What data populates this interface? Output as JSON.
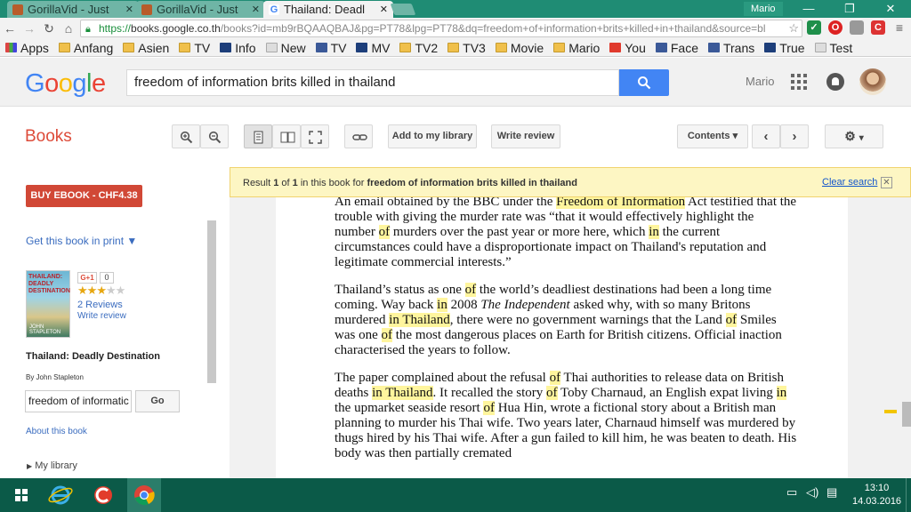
{
  "browser": {
    "tabs": [
      {
        "title": "GorillaVid - Just"
      },
      {
        "title": "GorillaVid - Just"
      },
      {
        "title": "Thailand: Deadl"
      }
    ],
    "window_user": "Mario",
    "url_https": "https://",
    "url_host": "books.google.co.th",
    "url_path": "/books?id=mb9rBQAAQBAJ&pg=PT78&lpg=PT78&dq=freedom+of+information+brits+killed+in+thailand&source=bl",
    "bookmarks": [
      "Apps",
      "Anfang",
      "Asien",
      "TV",
      "Info",
      "New",
      "TV",
      "MV",
      "TV2",
      "TV3",
      "Movie",
      "Mario",
      "You",
      "Face",
      "Trans",
      "True",
      "Test"
    ]
  },
  "google": {
    "search_query": "freedom of information brits killed in thailand",
    "username": "Mario"
  },
  "books": {
    "section_title": "Books",
    "add_library": "Add to my library",
    "write_review": "Write review",
    "contents": "Contents"
  },
  "result": {
    "prefix": "Result ",
    "n1": "1",
    "of": " of ",
    "n2": "1",
    "mid": " in this book for ",
    "query": "freedom of information brits killed in thailand",
    "clear": "Clear search"
  },
  "sidebar": {
    "buy": "BUY EBOOK - CHF4.38",
    "get_print": "Get this book in print ▼",
    "cover_title": "THAILAND: DEADLY DESTINATION",
    "cover_author": "JOHN STAPLETON",
    "gplus": "G+1",
    "gplus_count": "0",
    "rating": 3,
    "rating_max": 5,
    "reviews": "2 Reviews",
    "write_review": "Write review",
    "book_title": "Thailand: Deadly Destination",
    "by": "By John Stapleton",
    "search_value": "freedom of informatic",
    "go": "Go",
    "about": "About this book",
    "my_library": "My library"
  },
  "page_text": {
    "p1": [
      {
        "t": "An email obtained by the BBC under the "
      },
      {
        "t": "Freedom of Information",
        "h": true
      },
      {
        "t": " Act testified that the trouble with giving the murder rate was “that it would effectively highlight the number "
      },
      {
        "t": "of",
        "h": true
      },
      {
        "t": " murders over the past year or more here, which "
      },
      {
        "t": "in",
        "h": true
      },
      {
        "t": " the current circumstances could have a disproportionate impact on Thailand's reputation and legitimate commercial interests.”"
      }
    ],
    "p2": [
      {
        "t": "Thailand’s status as one "
      },
      {
        "t": "of",
        "h": true
      },
      {
        "t": " the world’s deadliest destinations had been a long time coming. Way back "
      },
      {
        "t": "in",
        "h": true
      },
      {
        "t": " 2008 "
      },
      {
        "t": "The Independent",
        "i": true
      },
      {
        "t": " asked why, with so many Britons murdered "
      },
      {
        "t": "in Thailand",
        "h": true
      },
      {
        "t": ", there were no government warnings that the Land "
      },
      {
        "t": "of",
        "h": true
      },
      {
        "t": " Smiles was one "
      },
      {
        "t": "of",
        "h": true
      },
      {
        "t": " the most dangerous places on Earth for British citizens. Official inaction characterised the years to follow."
      }
    ],
    "p3": [
      {
        "t": "The paper complained about the refusal "
      },
      {
        "t": "of",
        "h": true
      },
      {
        "t": " Thai authorities to release data on British deaths "
      },
      {
        "t": "in Thailand",
        "h": true
      },
      {
        "t": ". It recalled the story "
      },
      {
        "t": "of",
        "h": true
      },
      {
        "t": " Toby Charnaud, an English expat living "
      },
      {
        "t": "in",
        "h": true
      },
      {
        "t": " the upmarket seaside resort "
      },
      {
        "t": "of",
        "h": true
      },
      {
        "t": " Hua Hin, wrote a fictional story about a British man planning to murder his Thai wife. Two years later, Charnaud himself was murdered by thugs hired by his Thai wife. After a gun failed to kill him, he was beaten to death. His body was then partially cremated"
      }
    ]
  },
  "taskbar": {
    "time": "13:10",
    "date": "14.03.2016"
  }
}
